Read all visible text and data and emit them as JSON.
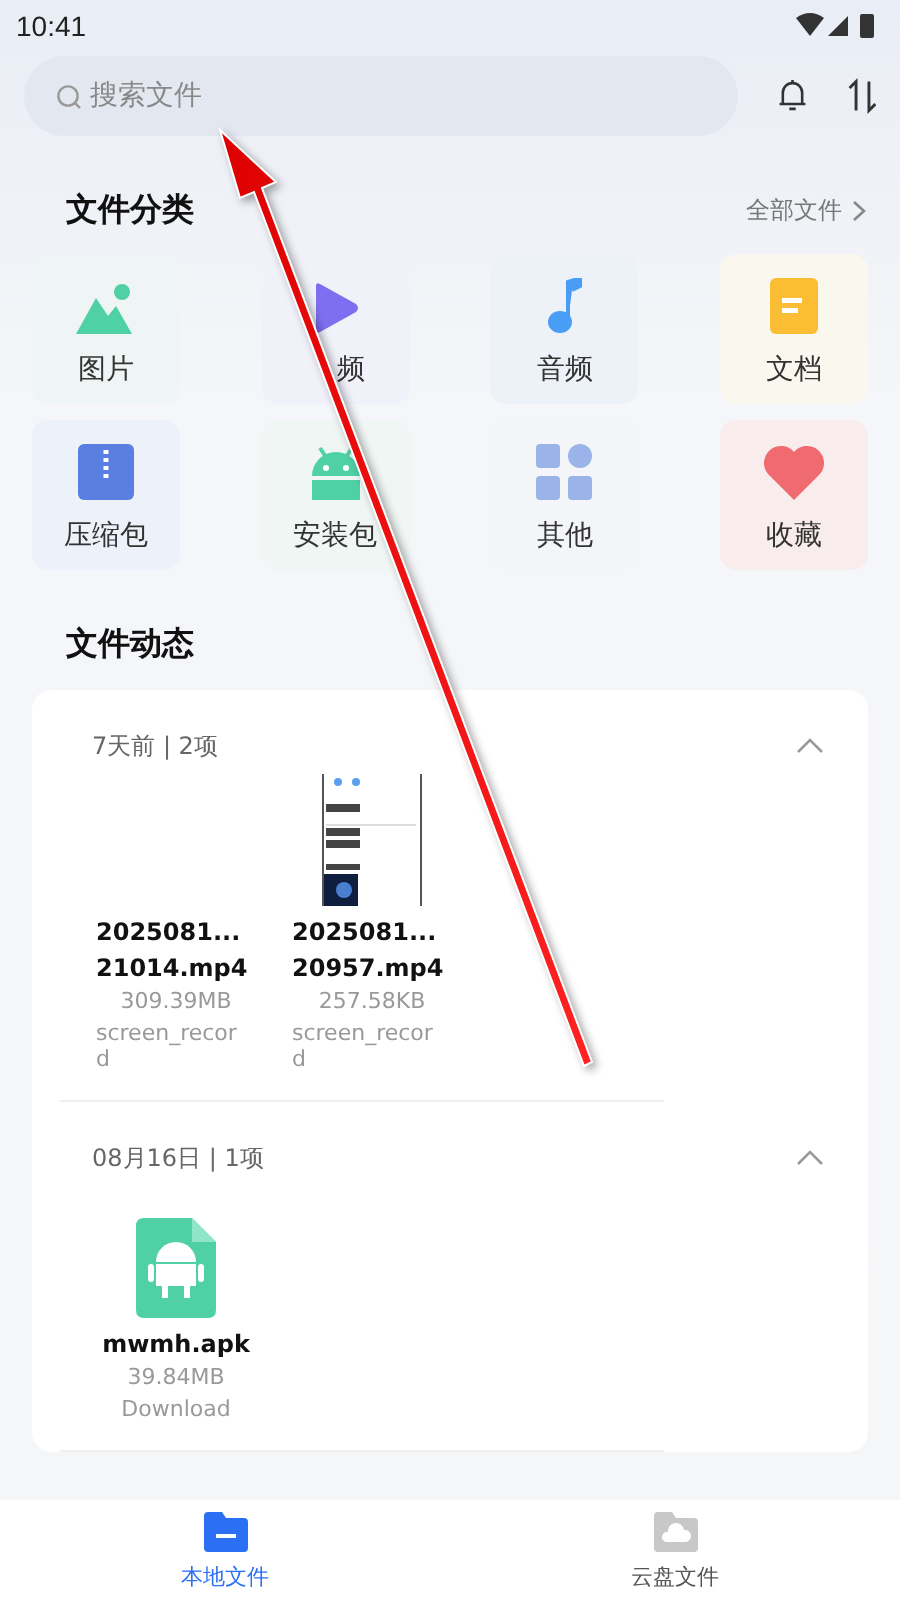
{
  "status_bar": {
    "time": "10:41"
  },
  "search": {
    "placeholder": "搜索文件"
  },
  "categories": {
    "title": "文件分类",
    "all_link": "全部文件",
    "items": [
      {
        "label": "图片"
      },
      {
        "label": "频",
        "kind": "video"
      },
      {
        "label": "音频",
        "kind": "audio"
      },
      {
        "label": "文档",
        "kind": "document"
      },
      {
        "label": "压缩包",
        "kind": "archive"
      },
      {
        "label": "安装包",
        "kind": "apk"
      },
      {
        "label": "其他",
        "kind": "other"
      },
      {
        "label": "收藏",
        "kind": "favorite"
      }
    ]
  },
  "activity": {
    "title": "文件动态",
    "groups": [
      {
        "header": "7天前 | 2项",
        "expanded": true,
        "files": [
          {
            "name": "2025081...\n21014.mp4",
            "size": "309.39MB",
            "folder": "screen_recor\nd",
            "kind": "blank"
          },
          {
            "name": "2025081...\n20957.mp4",
            "size": "257.58KB",
            "folder": "screen_recor\nd",
            "kind": "screenshot"
          }
        ]
      },
      {
        "header": "08月16日 | 1项",
        "expanded": true,
        "files": [
          {
            "name": "mwmh.apk",
            "size": "39.84MB",
            "folder": "Download",
            "kind": "apk"
          }
        ]
      }
    ]
  },
  "bottom_nav": [
    {
      "label": "本地文件",
      "selected": true
    },
    {
      "label": "云盘文件",
      "selected": false
    }
  ]
}
